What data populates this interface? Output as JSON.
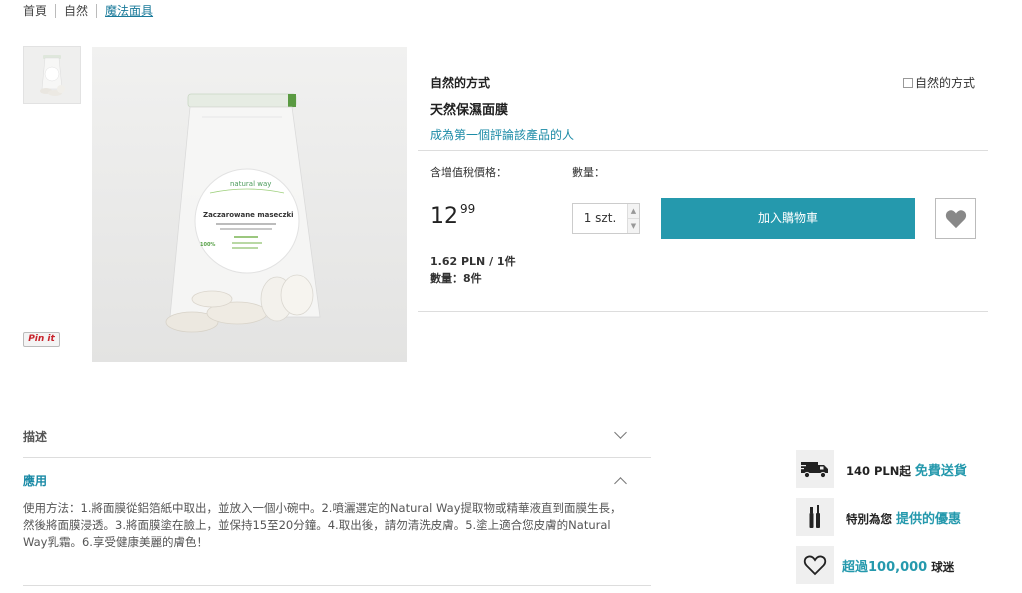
{
  "breadcrumb": [
    "首頁",
    "自然",
    "魔法面具"
  ],
  "gallery": {
    "pin_label": "Pin it",
    "package": {
      "brand": "natural way",
      "name": "Zaczarowane maseczki",
      "percent": "100%"
    }
  },
  "product": {
    "brand": "自然的方式",
    "brand_logo_alt": "自然的方式",
    "title": "天然保濕面膜",
    "review_link": "成為第一個評論該產品的人",
    "price_label": "含增值稅價格：",
    "qty_label": "數量：",
    "price_int": "12",
    "price_dec": "99",
    "qty_value": "1 szt.",
    "add_to_cart": "加入購物車",
    "unit_price": "1.62 PLN / 1件",
    "stock": "數量：8件"
  },
  "accordion": {
    "description_title": "描述",
    "usage_title": "應用",
    "usage_text": "使用方法：1.將面膜從鋁箔紙中取出，並放入一個小碗中。2.噴灑選定的Natural Way提取物或精華液直到面膜生長，然後將面膜浸透。3.將面膜塗在臉上，並保持15至20分鐘。4.取出後，請勿清洗皮膚。5.塗上適合您皮膚的Natural Way乳霜。6.享受健康美麗的膚色！"
  },
  "perks": {
    "shipping_prefix": "140 PLN起",
    "shipping_highlight": "免費送貨",
    "offer_prefix": "特別為您",
    "offer_highlight": "提供的優惠",
    "fans_highlight": "超過100,000",
    "fans_suffix": "球迷"
  },
  "colors": {
    "accent": "#2599ad",
    "link": "#1a8aa6"
  }
}
